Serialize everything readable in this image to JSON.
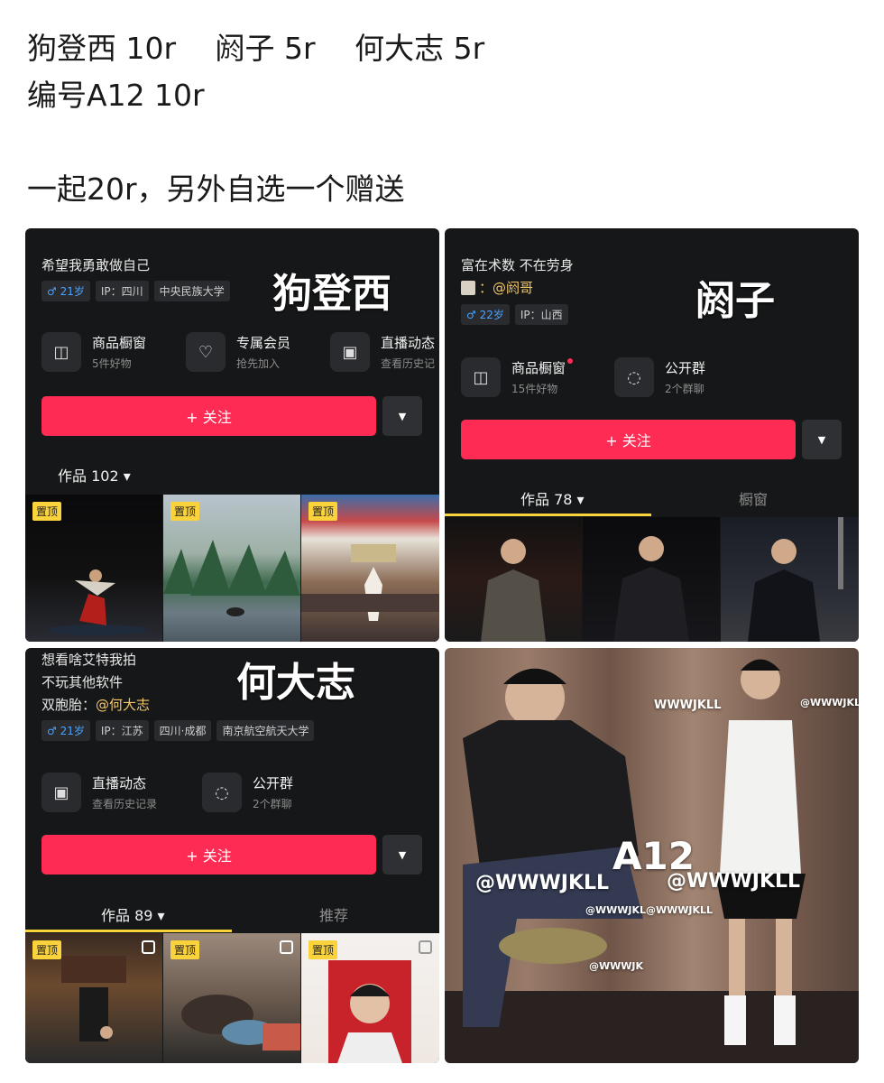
{
  "post": {
    "line1": "狗登西 10r　 阏子 5r　 何大志 5r",
    "line2": "编号A12 10r",
    "line3": "一起20r，另外自选一个赠送"
  },
  "colors": {
    "follow": "#fe2c55",
    "pin": "#fad23c",
    "male": "#4aa3ff"
  },
  "profile1": {
    "overlay_name": "狗登西",
    "signature": "希望我勇敢做自己",
    "tags": [
      "♂ 21岁",
      "IP：四川",
      "中央民族大学"
    ],
    "features": [
      {
        "icon": "shop-icon",
        "glyph": "◫",
        "title": "商品橱窗",
        "sub": "5件好物"
      },
      {
        "icon": "heart-v-icon",
        "glyph": "♡",
        "title": "专属会员",
        "sub": "抢先加入"
      },
      {
        "icon": "tv-icon",
        "glyph": "▣",
        "title": "直播动态",
        "sub": "查看历史记"
      }
    ],
    "follow_label": "+ 关注",
    "dropdown_glyph": "▼",
    "works_tab": "作品 102 ▾",
    "pin_label": "置顶"
  },
  "profile2": {
    "overlay_name": "阏子",
    "signature": "富在术数 不在劳身",
    "mention": "：@阏哥",
    "tags": [
      "♂ 22岁",
      "IP：山西"
    ],
    "features": [
      {
        "icon": "shop-icon",
        "glyph": "◫",
        "title": "商品橱窗",
        "sub": "15件好物"
      },
      {
        "icon": "chat-icon",
        "glyph": "◌",
        "title": "公开群",
        "sub": "2个群聊"
      }
    ],
    "follow_label": "+ 关注",
    "dropdown_glyph": "▼",
    "works_tab": "作品 78 ▾",
    "tab2": "橱窗"
  },
  "profile3": {
    "overlay_name": "何大志",
    "sig1": "想看啥艾特我拍",
    "sig2": "不玩其他软件",
    "sig3_prefix": "双胞胎：",
    "sig3_mention": "@何大志",
    "tags": [
      "♂ 21岁",
      "IP：江苏",
      "四川·成都",
      "南京航空航天大学"
    ],
    "features": [
      {
        "icon": "tv-icon",
        "glyph": "▣",
        "title": "直播动态",
        "sub": "查看历史记录"
      },
      {
        "icon": "chat-icon",
        "glyph": "◌",
        "title": "公开群",
        "sub": "2个群聊"
      }
    ],
    "follow_label": "+ 关注",
    "dropdown_glyph": "▼",
    "works_tab": "作品 89 ▾",
    "tab2": "推荐",
    "pin_label": "置顶"
  },
  "photo4": {
    "label": "A12",
    "wm_big1": "@WWWJKLL",
    "wm_big2": "@WWWJKLL",
    "wm_small1": "WWWJKLL",
    "wm_small2": "@WWWJKLL",
    "wm_small3": "@WWWJKL@WWWJKLL",
    "wm_small4": "@WWWJK"
  }
}
